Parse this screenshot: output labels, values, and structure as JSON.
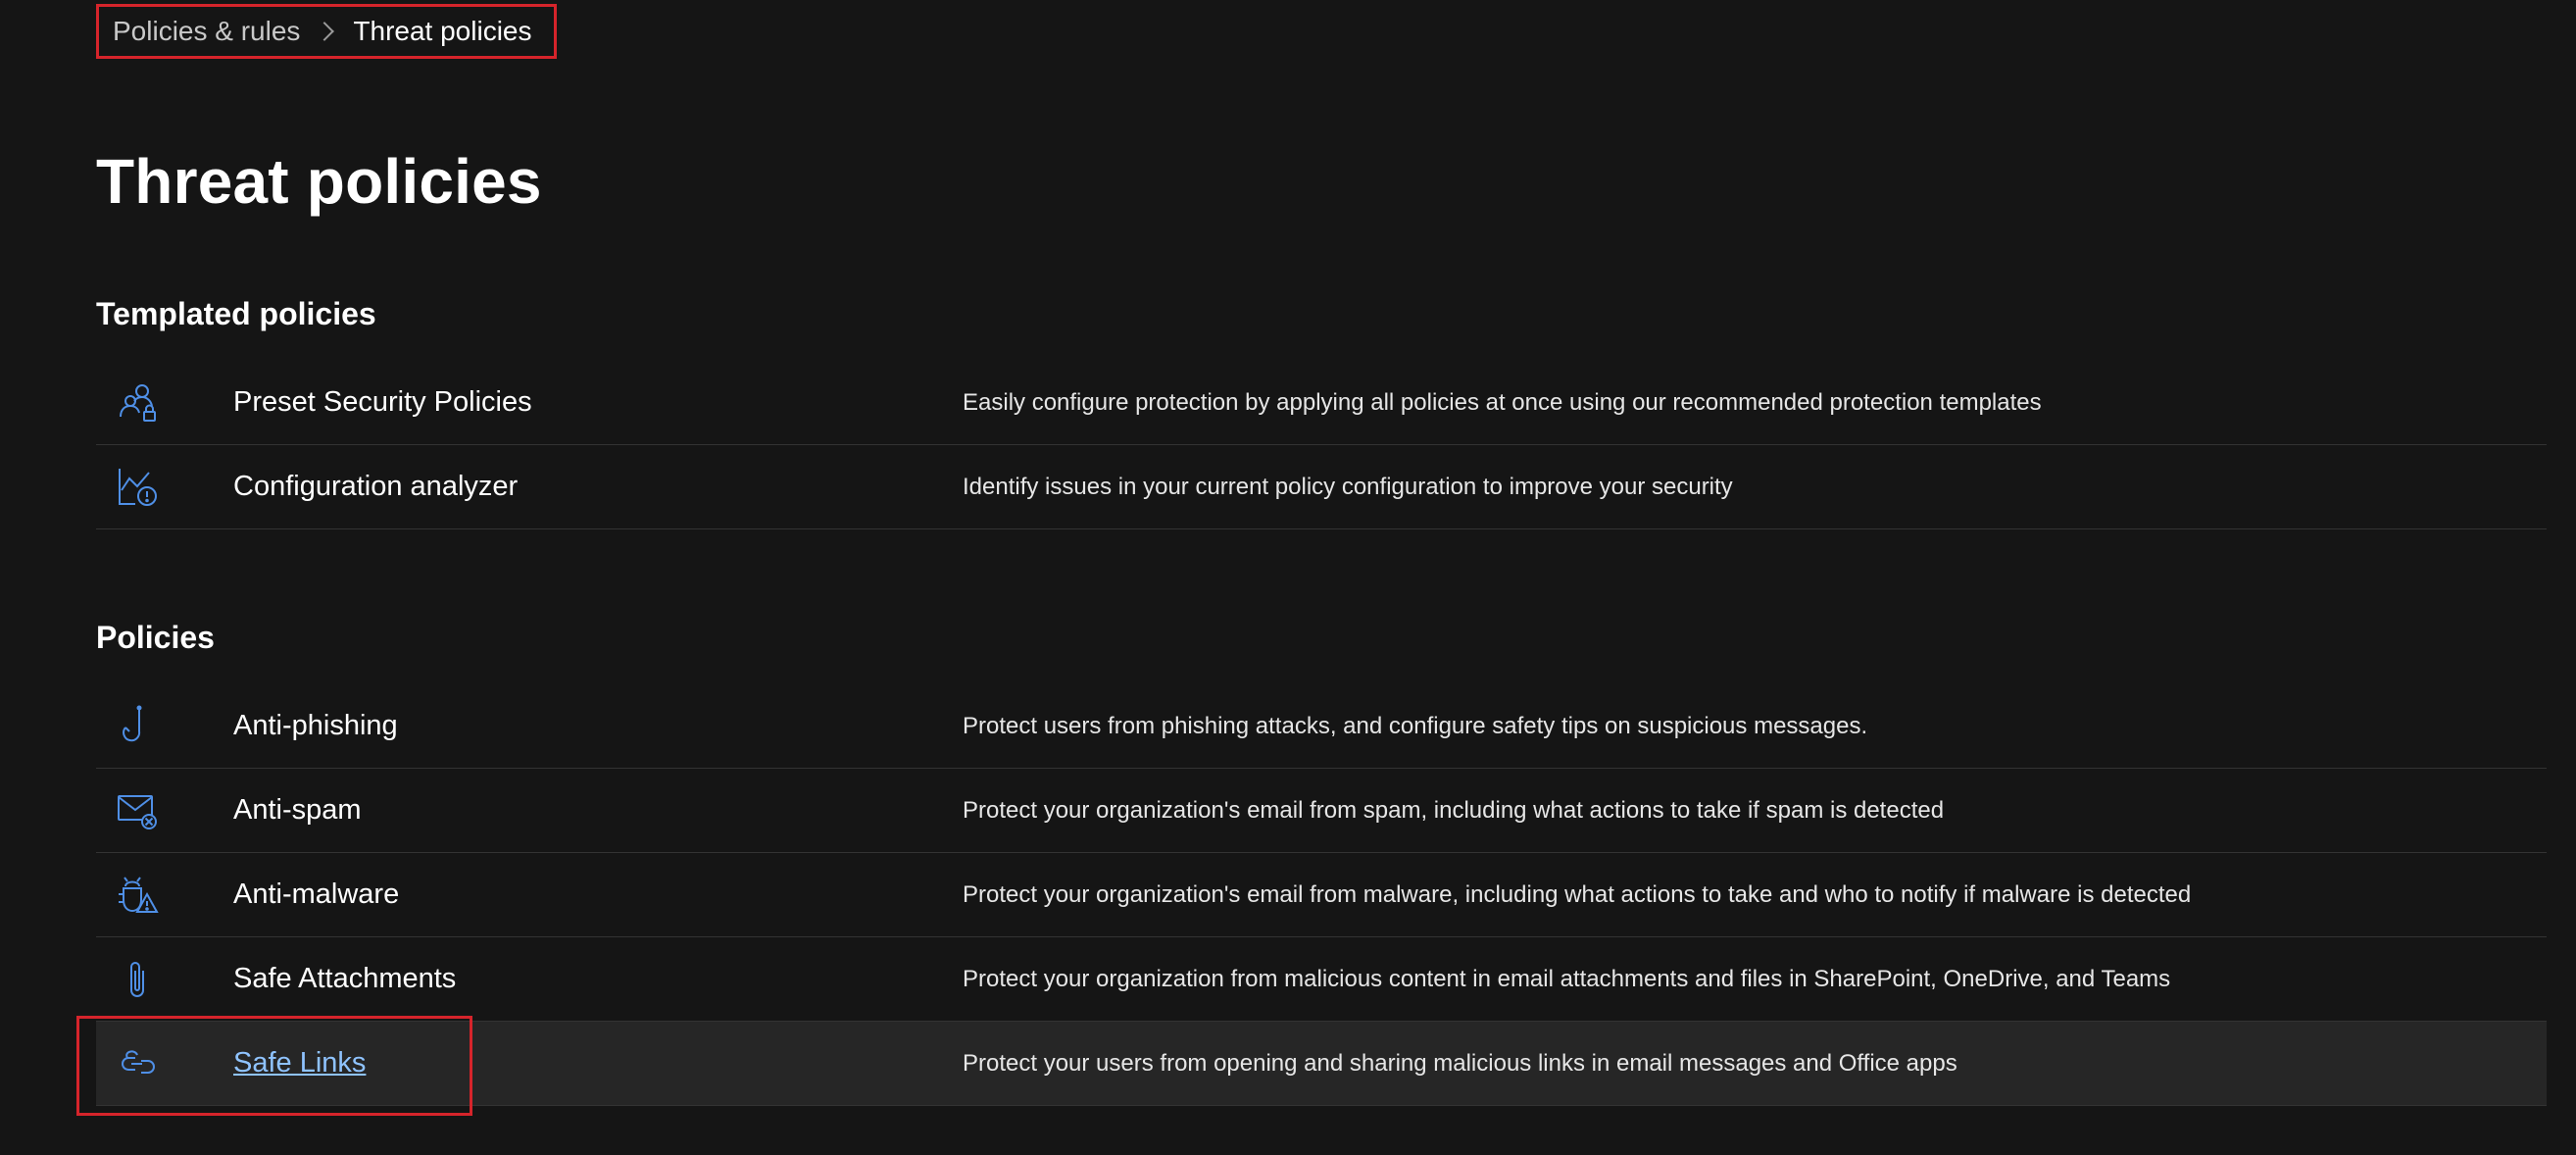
{
  "breadcrumb": {
    "root": "Policies & rules",
    "current": "Threat policies"
  },
  "page_title": "Threat policies",
  "templated_section": {
    "title": "Templated policies",
    "items": [
      {
        "icon": "people-lock-icon",
        "label": "Preset Security Policies",
        "description": "Easily configure protection by applying all policies at once using our recommended protection templates"
      },
      {
        "icon": "chart-alert-icon",
        "label": "Configuration analyzer",
        "description": "Identify issues in your current policy configuration to improve your security"
      }
    ]
  },
  "policies_section": {
    "title": "Policies",
    "items": [
      {
        "icon": "fish-hook-icon",
        "label": "Anti-phishing",
        "description": "Protect users from phishing attacks, and configure safety tips on suspicious messages."
      },
      {
        "icon": "mail-block-icon",
        "label": "Anti-spam",
        "description": "Protect your organization's email from spam, including what actions to take if spam is detected"
      },
      {
        "icon": "bug-warning-icon",
        "label": "Anti-malware",
        "description": "Protect your organization's email from malware, including what actions to take and who to notify if malware is detected"
      },
      {
        "icon": "paperclip-icon",
        "label": "Safe Attachments",
        "description": "Protect your organization from malicious content in email attachments and files in SharePoint, OneDrive, and Teams"
      },
      {
        "icon": "link-icon",
        "label": "Safe Links",
        "description": "Protect your users from opening and sharing malicious links in email messages and Office apps"
      }
    ]
  },
  "colors": {
    "background": "#151515",
    "icon": "#4f8fe6",
    "link": "#8fc3ff",
    "highlight_border": "#d6242b",
    "selected_row": "#262626"
  }
}
